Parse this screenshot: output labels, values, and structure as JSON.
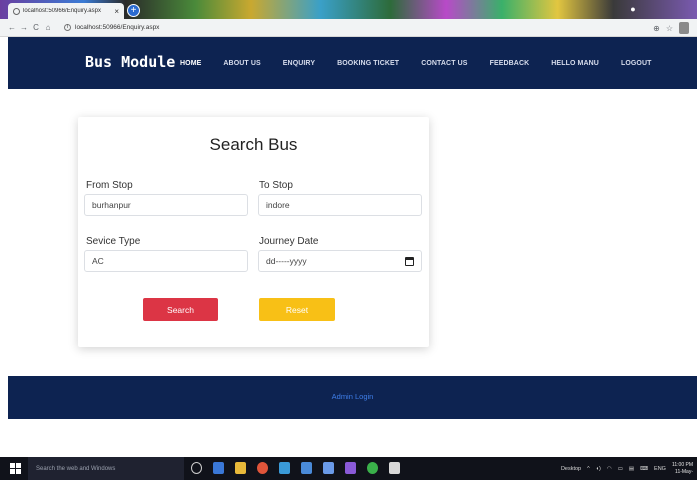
{
  "browser": {
    "tab_title": "localhost:50966/Enquiry.aspx",
    "tab_close": "×",
    "new_tab": "+",
    "url": "localhost:50966/Enquiry.aspx",
    "nav": {
      "back": "←",
      "forward": "→",
      "reload": "C",
      "home": "⌂"
    },
    "right": {
      "zoom": "⊕",
      "star": "☆"
    }
  },
  "header": {
    "brand": "Bus Module",
    "nav": [
      {
        "label": "HOME",
        "active": true
      },
      {
        "label": "ABOUT US"
      },
      {
        "label": "ENQUIRY"
      },
      {
        "label": "BOOKING TICKET"
      },
      {
        "label": "CONTACT US"
      },
      {
        "label": "FEEDBACK"
      },
      {
        "label": "HELLO MANU"
      },
      {
        "label": "LOGOUT"
      }
    ]
  },
  "form": {
    "title": "Search Bus",
    "from_label": "From Stop",
    "from_value": "burhanpur",
    "to_label": "To Stop",
    "to_value": "indore",
    "service_label": "Sevice Type",
    "service_value": "AC",
    "date_label": "Journey Date",
    "date_value": "dd-----yyyy",
    "search_button": "Search",
    "reset_button": "Reset"
  },
  "footer": {
    "admin_link": "Admin Login"
  },
  "taskbar": {
    "search_placeholder": "Search the web and Windows",
    "desktop_label": "Desktop",
    "lang": "ENG",
    "time": "11:00 PM",
    "date": "11-May-"
  },
  "colors": {
    "header_bg": "#0d2351",
    "search_button": "#dc3545",
    "reset_button": "#f8c016",
    "admin_link": "#3f7ee8"
  }
}
